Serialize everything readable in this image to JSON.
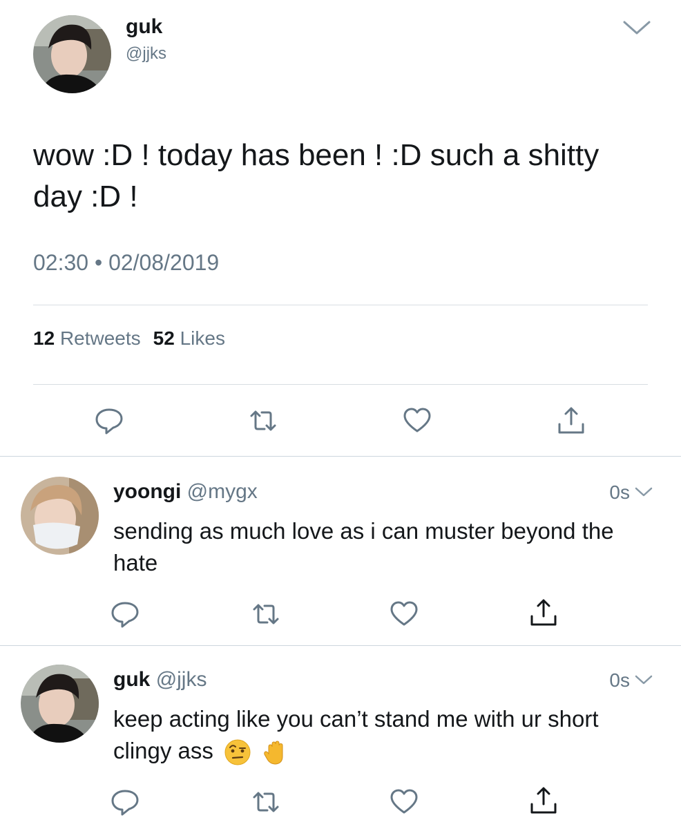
{
  "main_tweet": {
    "author_name": "guk",
    "author_handle": "@jjks",
    "text": "wow :D ! today has been ! :D such a shitty day :D !",
    "time": "02:30",
    "separator": "•",
    "date": "02/08/2019",
    "retweet_count": "12",
    "retweet_label": "Retweets",
    "like_count": "52",
    "like_label": "Likes",
    "icons": [
      "reply-icon",
      "retweet-icon",
      "like-icon",
      "share-icon"
    ]
  },
  "replies": [
    {
      "author_name": "yoongi",
      "author_handle": "@mygx",
      "time": "0s",
      "text": "sending as much love as i can muster beyond the hate"
    },
    {
      "author_name": "guk",
      "author_handle": "@jjks",
      "time": "0s",
      "text": "keep acting like you can’t stand me with ur short clingy ass",
      "emojis": [
        "raised-eyebrow-face-emoji",
        "raised-hand-emoji"
      ]
    }
  ],
  "colors": {
    "text_primary": "#14171a",
    "text_secondary": "#657786",
    "divider": "#ccd6dd",
    "icon": "#657786"
  }
}
